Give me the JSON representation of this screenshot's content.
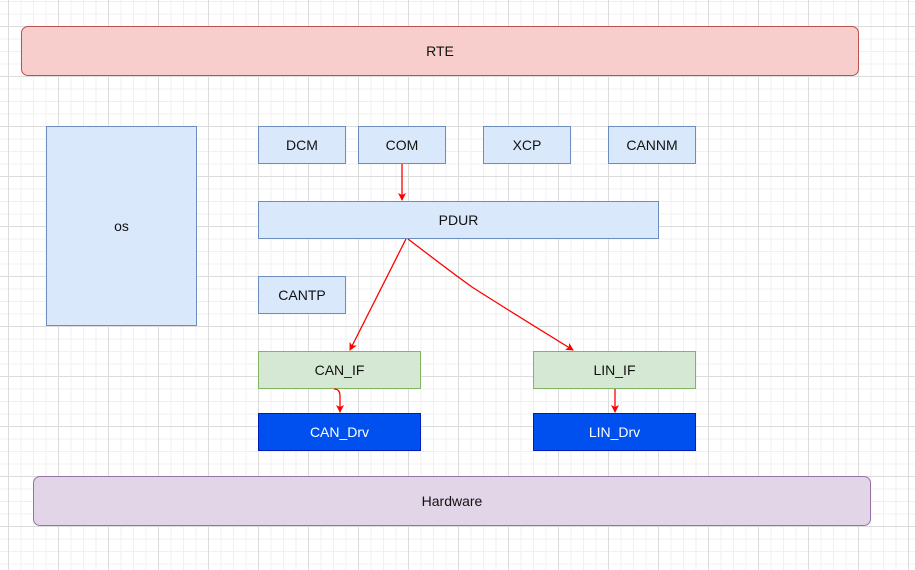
{
  "colors": {
    "rte_fill": "#f8cecc",
    "rte_stroke": "#b85450",
    "module_fill": "#dae8fc",
    "module_stroke": "#6c8ebf",
    "if_fill": "#d5e8d4",
    "if_stroke": "#82b366",
    "drv_fill": "#0050ef",
    "hw_fill": "#e1d5e7",
    "hw_stroke": "#9673a6",
    "arrow": "#ff0000"
  },
  "nodes": {
    "rte": "RTE",
    "os": "os",
    "dcm": "DCM",
    "com": "COM",
    "xcp": "XCP",
    "cannm": "CANNM",
    "pdur": "PDUR",
    "cantp": "CANTP",
    "can_if": "CAN_IF",
    "lin_if": "LIN_IF",
    "can_drv": "CAN_Drv",
    "lin_drv": "LIN_Drv",
    "hardware": "Hardware"
  },
  "edges": [
    {
      "from": "COM",
      "to": "PDUR"
    },
    {
      "from": "PDUR",
      "to": "CAN_IF"
    },
    {
      "from": "PDUR",
      "to": "LIN_IF"
    },
    {
      "from": "CAN_IF",
      "to": "CAN_Drv"
    },
    {
      "from": "LIN_IF",
      "to": "LIN_Drv"
    }
  ]
}
